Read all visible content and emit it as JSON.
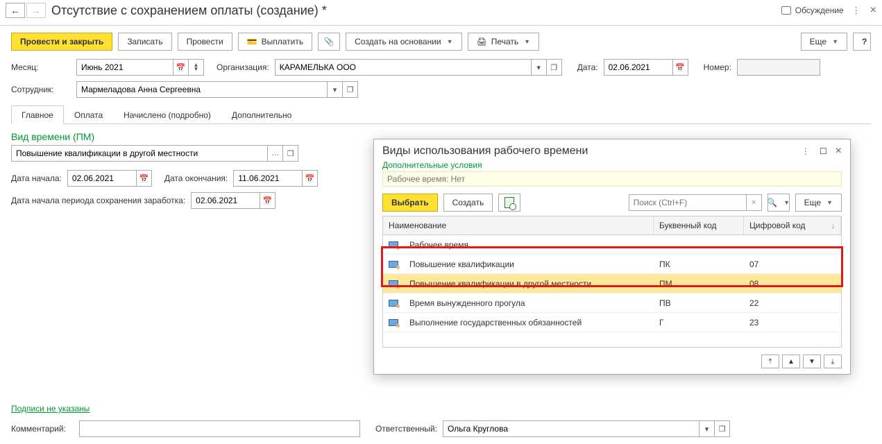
{
  "title": "Отсутствие с сохранением оплаты (создание) *",
  "discuss": "Обсуждение",
  "cmd": {
    "post_close": "Провести и закрыть",
    "save": "Записать",
    "post": "Провести",
    "pay": "Выплатить",
    "create_based": "Создать на основании",
    "print": "Печать",
    "more": "Еще",
    "help": "?"
  },
  "form": {
    "month_lbl": "Месяц:",
    "month_val": "Июнь 2021",
    "org_lbl": "Организация:",
    "org_val": "КАРАМЕЛЬКА ООО",
    "date_lbl": "Дата:",
    "date_val": "02.06.2021",
    "num_lbl": "Номер:",
    "num_val": "",
    "emp_lbl": "Сотрудник:",
    "emp_val": "Мармеладова Анна Сергеевна"
  },
  "tabs": {
    "main": "Главное",
    "pay": "Оплата",
    "accrued": "Начислено (подробно)",
    "additional": "Дополнительно"
  },
  "main": {
    "section": "Вид времени (ПМ)",
    "timetype": "Повышение квалификации в другой местности",
    "start_lbl": "Дата начала:",
    "start_val": "02.06.2021",
    "end_lbl": "Дата окончания:",
    "end_val": "11.06.2021",
    "period_lbl": "Дата начала периода сохранения заработка:",
    "period_val": "02.06.2021"
  },
  "footer": {
    "signatures": "Подписи не указаны",
    "comment_lbl": "Комментарий:",
    "comment_val": "",
    "resp_lbl": "Ответственный:",
    "resp_val": "Ольга Круглова"
  },
  "popup": {
    "title": "Виды использования рабочего времени",
    "extra": "Дополнительные условия",
    "worktime": "Рабочее время: Нет",
    "select": "Выбрать",
    "create": "Создать",
    "search_ph": "Поиск (Ctrl+F)",
    "more": "Еще",
    "col_name": "Наименование",
    "col_code": "Буквенный код",
    "col_num": "Цифровой код",
    "rows": [
      {
        "name": "Рабочее время",
        "code": "",
        "num": ""
      },
      {
        "name": "Повышение квалификации",
        "code": "ПК",
        "num": "07"
      },
      {
        "name": "Повышение квалификации в другой местности",
        "code": "ПМ",
        "num": "08"
      },
      {
        "name": "Время вынужденного прогула",
        "code": "ПВ",
        "num": "22"
      },
      {
        "name": "Выполнение государственных обязанностей",
        "code": "Г",
        "num": "23"
      }
    ]
  }
}
